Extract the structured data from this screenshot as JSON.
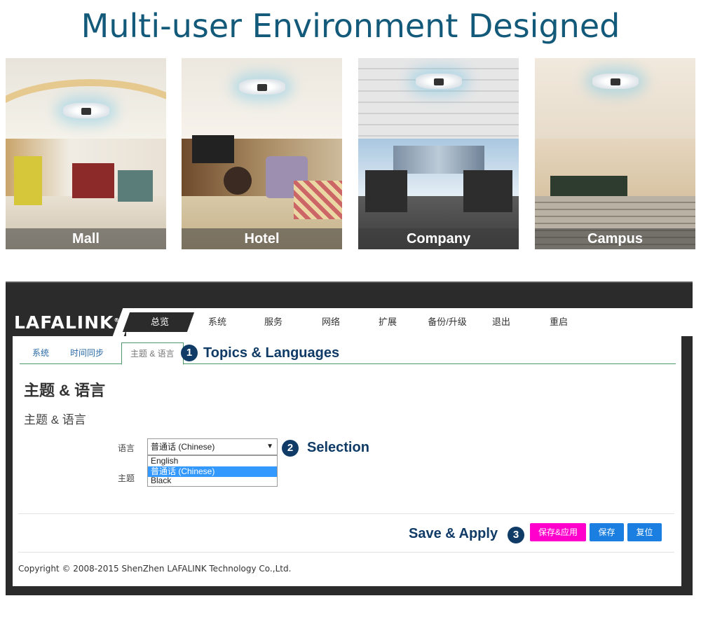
{
  "headline": "Multi-user Environment Designed",
  "scenes": [
    {
      "label": "Mall"
    },
    {
      "label": "Hotel"
    },
    {
      "label": "Company"
    },
    {
      "label": "Campus"
    }
  ],
  "logo": {
    "text": "LAFALINK",
    "mark": "®"
  },
  "nav": [
    "总览",
    "系统",
    "服务",
    "网络",
    "扩展",
    "备份/升级",
    "退出",
    "重启"
  ],
  "tabs": [
    "系统",
    "时间同步",
    "主题 & 语言"
  ],
  "callouts": {
    "one": {
      "num": "1",
      "text": "Topics & Languages"
    },
    "two": {
      "num": "2",
      "text": "Selection"
    },
    "three": {
      "num": "3",
      "text": "Save & Apply"
    }
  },
  "page": {
    "title": "主题 & 语言",
    "subtitle": "主题 & 语言"
  },
  "form": {
    "language_label": "语言",
    "theme_label": "主题",
    "language_value": "普通话 (Chinese)",
    "options": [
      "English",
      "普通话 (Chinese)"
    ],
    "theme_value": "Black"
  },
  "buttons": {
    "save_apply": "保存&应用",
    "save": "保存",
    "reset": "复位"
  },
  "colors": {
    "save_apply": "#ff00cc",
    "save": "#1a7fe0",
    "reset": "#1a7fe0",
    "accent": "#0f3b66"
  },
  "footer": {
    "copyright": "Copyright © 2008-2015 ShenZhen LAFALINK Technology Co.,Ltd."
  }
}
